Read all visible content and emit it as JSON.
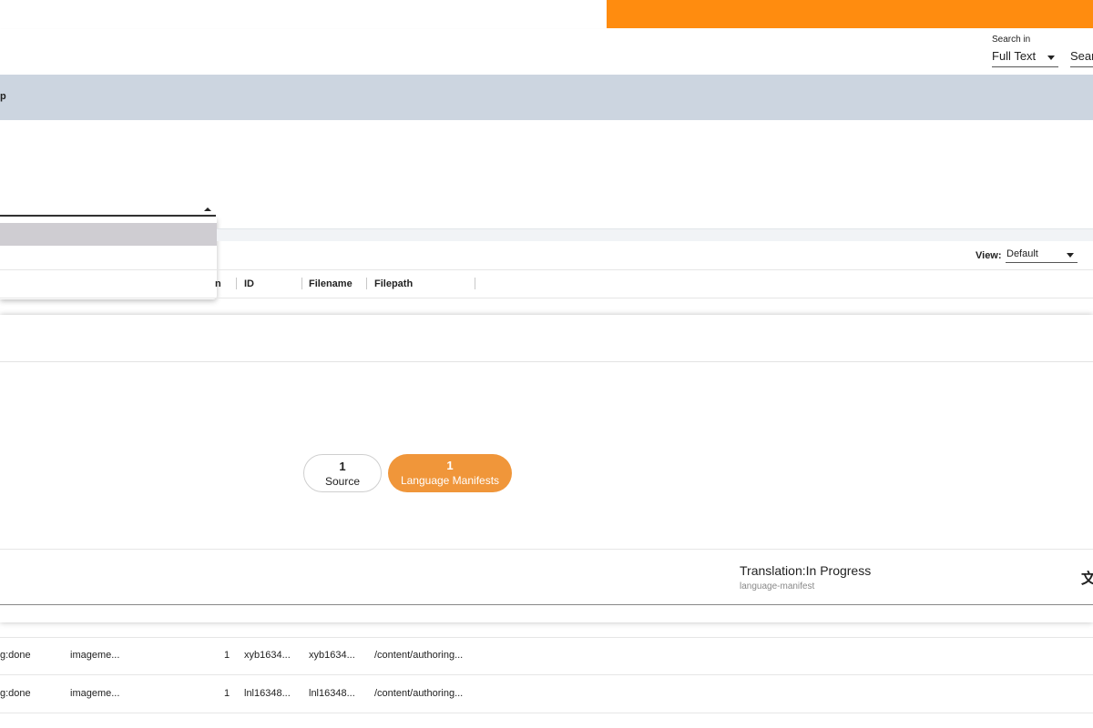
{
  "colors": {
    "accent_orange": "#ff8c0f",
    "pill_orange": "#f0963a",
    "band": "#ccd5e0"
  },
  "header": {
    "search_in_label": "Search in",
    "search_in_value": "Full Text",
    "search_placeholder": "Sear"
  },
  "band": {
    "title_fragment": "p"
  },
  "view": {
    "label": "View:",
    "value": "Default"
  },
  "table": {
    "columns": [
      "n",
      "ID",
      "Filename",
      "Filepath"
    ],
    "rows": [
      {
        "status": "g:done",
        "type": "imageme...",
        "n": "1",
        "id": "xyb1634...",
        "filename": "xyb1634...",
        "filepath": "/content/authoring..."
      },
      {
        "status": "g:done",
        "type": "imageme...",
        "n": "1",
        "id": "lnl16348...",
        "filename": "lnl16348...",
        "filepath": "/content/authoring..."
      }
    ]
  },
  "panel": {
    "pills": [
      {
        "count": "1",
        "label": "Source"
      },
      {
        "count": "1",
        "label": "Language Manifests"
      }
    ],
    "status_title": "Translation:In Progress",
    "status_subtitle": "language-manifest",
    "translate_icon": "translate-icon",
    "translate_glyph": "文"
  }
}
